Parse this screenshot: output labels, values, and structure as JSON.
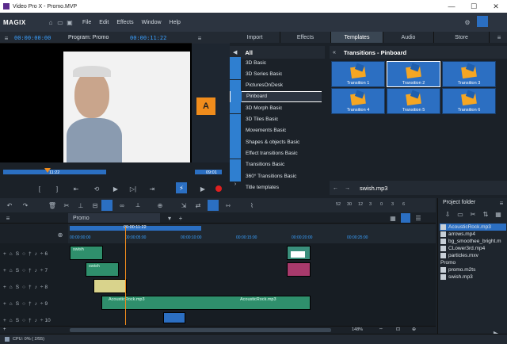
{
  "window": {
    "title": "Video Pro X - Promo.MVP"
  },
  "menu": {
    "brand": "MAGIX",
    "items": [
      "File",
      "Edit",
      "Effects",
      "Window",
      "Help"
    ]
  },
  "monitor": {
    "timecode_left": "00:00:00:00",
    "program_label": "Program: Promo",
    "timecode_right": "00:00:11:22",
    "scrub_left": "11:22",
    "scrub_right": "09:01",
    "badge_letter": "A"
  },
  "right_tabs": [
    "Import",
    "Effects",
    "Templates",
    "Audio",
    "Store"
  ],
  "templates": {
    "all_label": "All",
    "category_title": "Transitions - Pinboard",
    "items": [
      "3D Basic",
      "3D Series Basic",
      "PicturesOnDesk",
      "Pinboard",
      "3D Morph Basic",
      "3D Tiles Basic",
      "Movements Basic",
      "Shapes & objects Basic",
      "Effect transitions Basic",
      "Transitions Basic",
      "360° Transitions Basic",
      "Title templates"
    ],
    "thumbs": [
      "Transition 1",
      "Transition 2",
      "Transition 3",
      "Transition 4",
      "Transition 5",
      "Transition 6"
    ],
    "preview_file": "swish.mp3"
  },
  "timeline": {
    "tab": "Promo",
    "ruler_marks": [
      "00:00:00:00",
      "00:00:05:00",
      "00:00:10:00",
      "00:00:15:00",
      "00:00:20:00",
      "00:00:25:00"
    ],
    "range_label": "00:00:11:22",
    "zoom": "148%",
    "tracks": [
      "6",
      "7",
      "8",
      "9",
      "10"
    ],
    "clip_labels": {
      "audio1": "AcousticRock.mp3",
      "audio2": "AcousticRock.mp3",
      "swish1": "swish",
      "swish2": "swish"
    },
    "level_marks": [
      "52",
      "30",
      "12",
      "3",
      "0",
      "3",
      "6"
    ]
  },
  "project_folder": {
    "title": "Project folder",
    "files": [
      "AcousticRock.mp3",
      "arrows.mp4",
      "bg_smoothee_bright.m",
      "CLower3rd.mp4",
      "particles.mxv"
    ],
    "group": "Promo",
    "group_files": [
      "promo.m2ts",
      "swish.mp3"
    ]
  },
  "status": {
    "cpu": "CPU: 0% ( 2/55)"
  }
}
